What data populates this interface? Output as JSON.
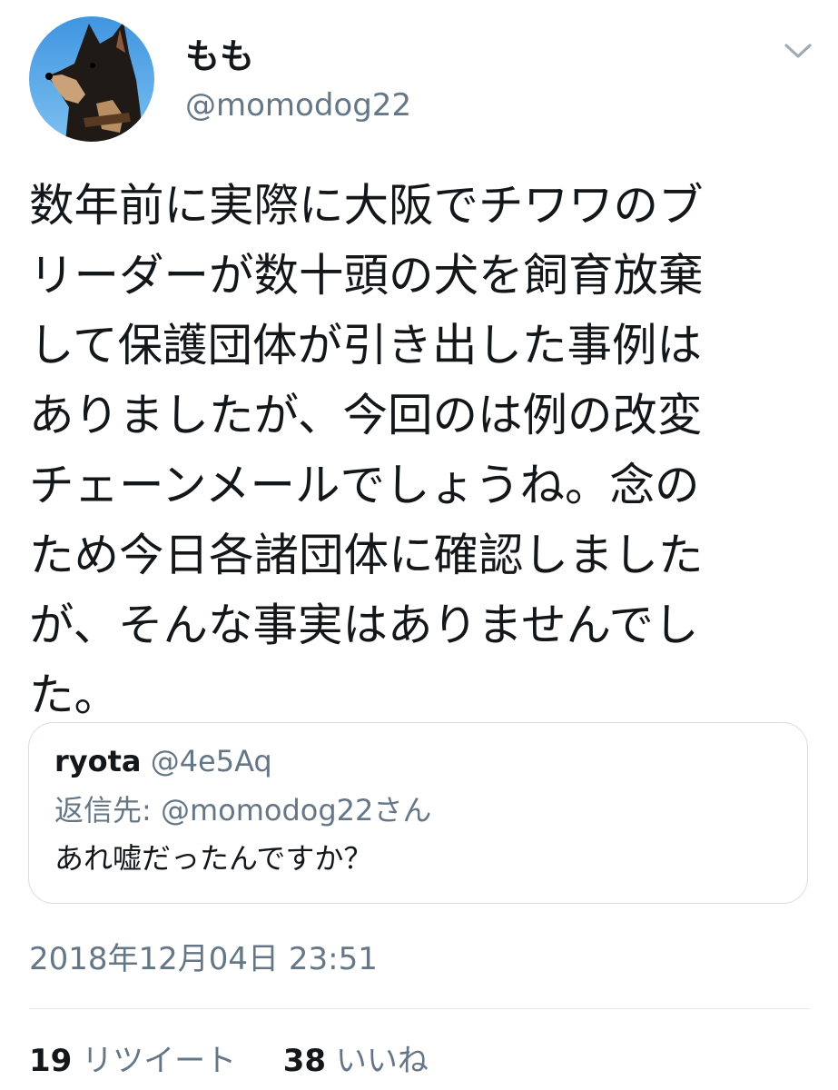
{
  "tweet": {
    "author": {
      "display_name": "もも",
      "handle": "@momodog22",
      "avatar": "dog-profile-photo"
    },
    "text_lines": [
      "数年前に実際に大阪でチワワのブ",
      "リーダーが数十頭の犬を飼育放棄",
      "して保護団体が引き出した事例は",
      "ありましたが、今回のは例の改変",
      "チェーンメールでしょうね。念の",
      "ため今日各諸団体に確認しました",
      "が、そんな事実はありませんでし",
      "た。"
    ],
    "quoted": {
      "name": "ryota",
      "handle": "@4e5Aq",
      "reply_to": "返信先: @momodog22さん",
      "text": "あれ嘘だったんですか？"
    },
    "timestamp": "2018年12月04日 23:51",
    "stats": {
      "retweets_count": "19",
      "retweets_label": "リツイート",
      "likes_count": "38",
      "likes_label": "いいね"
    }
  },
  "icons": {
    "menu": "chevron-down-icon"
  },
  "colors": {
    "primary_text": "#14171a",
    "secondary_text": "#657786",
    "border": "#d6dde3",
    "avatar_sky": "#4fa3e6"
  }
}
